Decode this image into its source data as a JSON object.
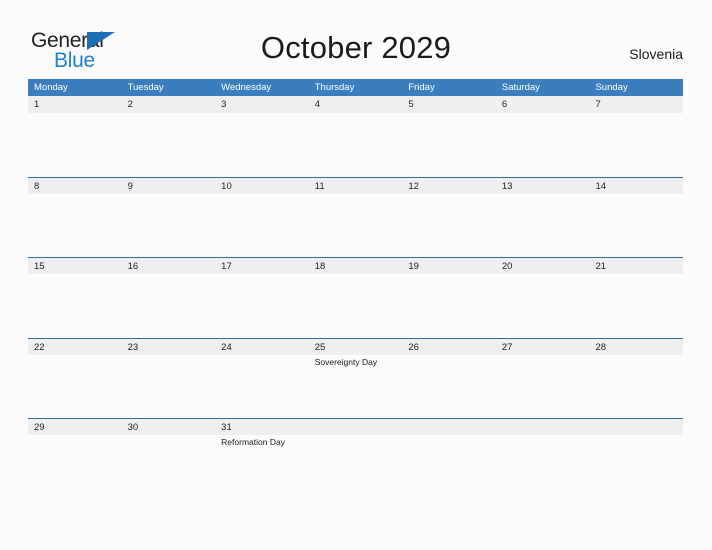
{
  "brand": {
    "name_part1": "General",
    "name_part2": "Blue",
    "triangle_color": "#1f6eb4",
    "blue_color": "#1f7fd0"
  },
  "header": {
    "title": "October 2029",
    "country": "Slovenia"
  },
  "theme": {
    "header_blue": "#3c7ebd",
    "row_line_blue": "#2f6ea5",
    "date_band_gray": "#efefef",
    "page_background": "#fcfcfc",
    "text_color": "#222222"
  },
  "calendar": {
    "month": "October",
    "year": "2029",
    "weekdays": [
      "Monday",
      "Tuesday",
      "Wednesday",
      "Thursday",
      "Friday",
      "Saturday",
      "Sunday"
    ],
    "weeks": [
      {
        "days": [
          {
            "date": "1",
            "event": ""
          },
          {
            "date": "2",
            "event": ""
          },
          {
            "date": "3",
            "event": ""
          },
          {
            "date": "4",
            "event": ""
          },
          {
            "date": "5",
            "event": ""
          },
          {
            "date": "6",
            "event": ""
          },
          {
            "date": "7",
            "event": ""
          }
        ]
      },
      {
        "days": [
          {
            "date": "8",
            "event": ""
          },
          {
            "date": "9",
            "event": ""
          },
          {
            "date": "10",
            "event": ""
          },
          {
            "date": "11",
            "event": ""
          },
          {
            "date": "12",
            "event": ""
          },
          {
            "date": "13",
            "event": ""
          },
          {
            "date": "14",
            "event": ""
          }
        ]
      },
      {
        "days": [
          {
            "date": "15",
            "event": ""
          },
          {
            "date": "16",
            "event": ""
          },
          {
            "date": "17",
            "event": ""
          },
          {
            "date": "18",
            "event": ""
          },
          {
            "date": "19",
            "event": ""
          },
          {
            "date": "20",
            "event": ""
          },
          {
            "date": "21",
            "event": ""
          }
        ]
      },
      {
        "days": [
          {
            "date": "22",
            "event": ""
          },
          {
            "date": "23",
            "event": ""
          },
          {
            "date": "24",
            "event": ""
          },
          {
            "date": "25",
            "event": "Sovereignty Day"
          },
          {
            "date": "26",
            "event": ""
          },
          {
            "date": "27",
            "event": ""
          },
          {
            "date": "28",
            "event": ""
          }
        ]
      },
      {
        "days": [
          {
            "date": "29",
            "event": ""
          },
          {
            "date": "30",
            "event": ""
          },
          {
            "date": "31",
            "event": "Reformation Day"
          },
          {
            "date": "",
            "event": ""
          },
          {
            "date": "",
            "event": ""
          },
          {
            "date": "",
            "event": ""
          },
          {
            "date": "",
            "event": ""
          }
        ]
      }
    ]
  }
}
